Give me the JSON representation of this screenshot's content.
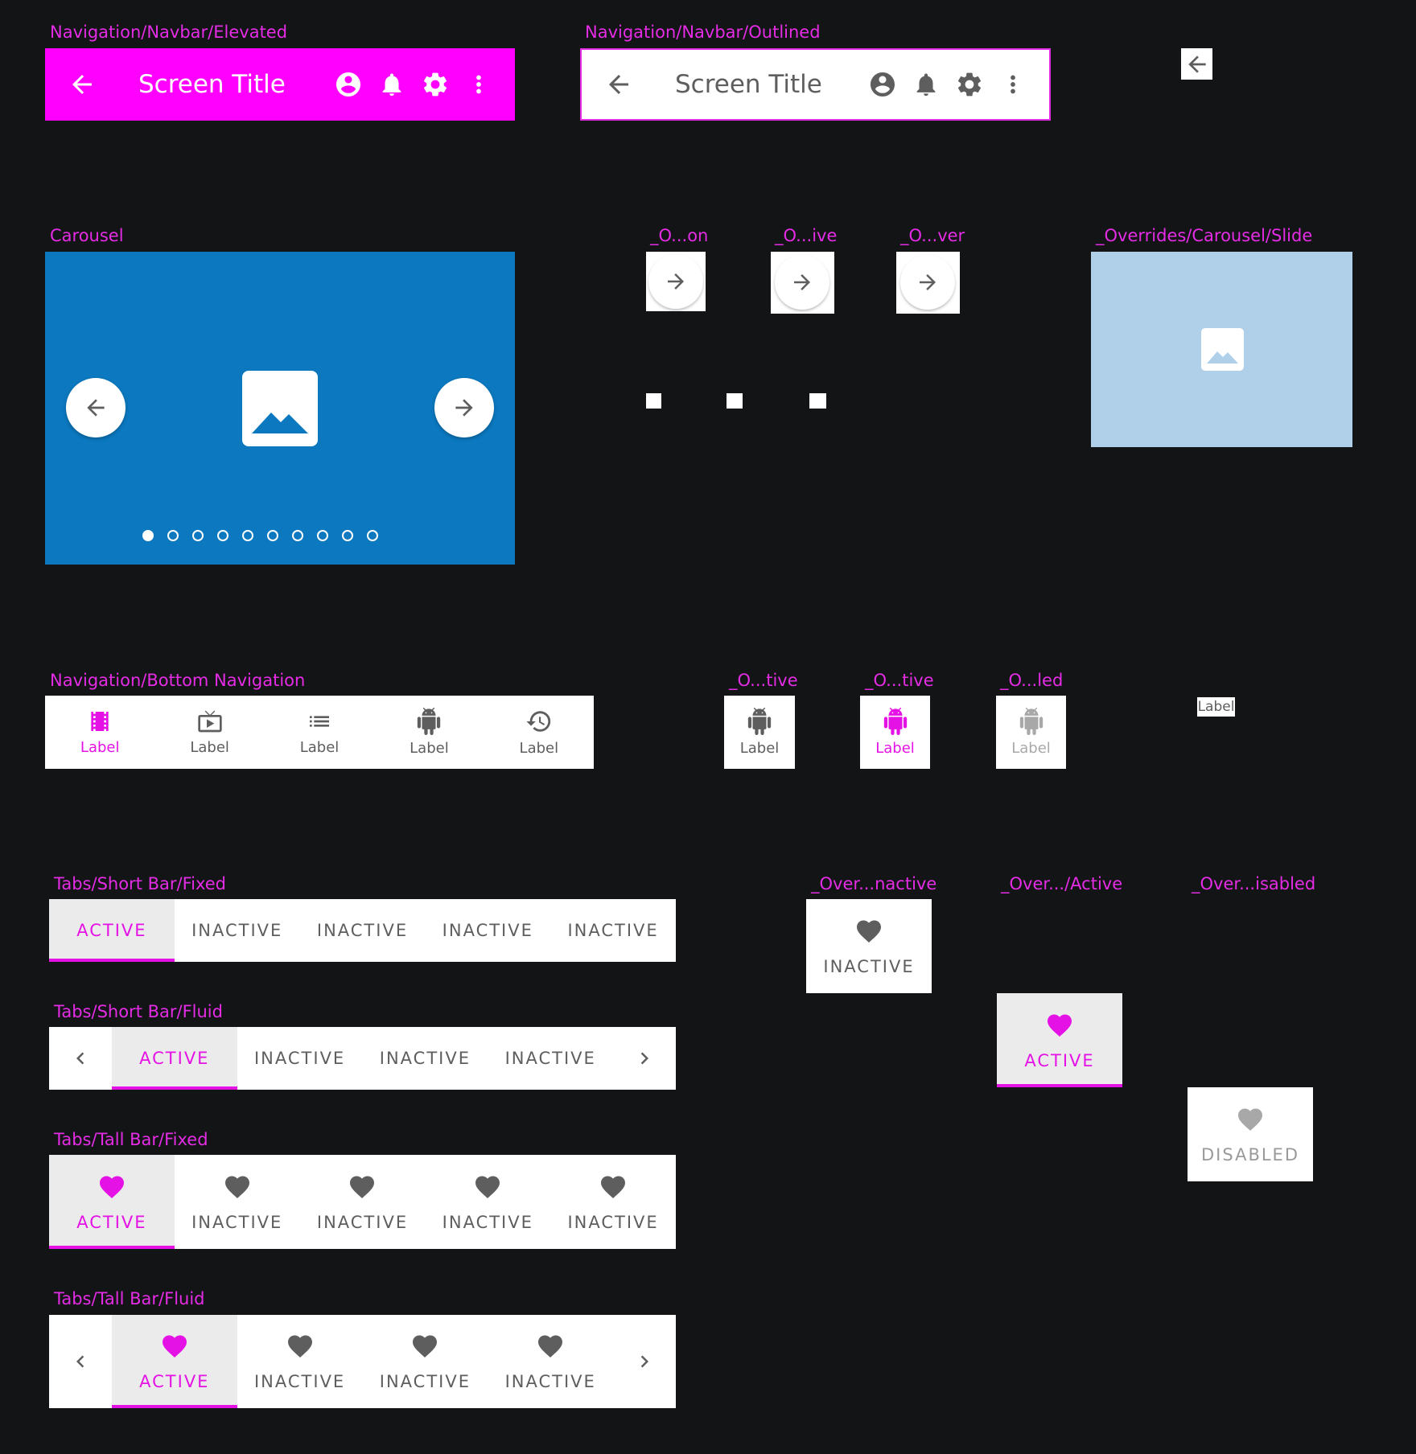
{
  "frames": {
    "navbar_elevated": "Navigation/Navbar/Elevated",
    "navbar_outlined": "Navigation/Navbar/Outlined",
    "carousel": "Carousel",
    "ov_button": "_O...on",
    "ov_active": "_O...ive",
    "ov_hover": "_O...ver",
    "ov_slide": "_Overrides/Carousel/Slide",
    "bottom_nav": "Navigation/Bottom Navigation",
    "bn_ov_inactive": "_O...tive",
    "bn_ov_active": "_O...tive",
    "bn_ov_disabled": "_O...led",
    "tabs_short_fixed": "Tabs/Short Bar/Fixed",
    "tabs_short_fluid": "Tabs/Short Bar/Fluid",
    "tabs_tall_fixed": "Tabs/Tall Bar/Fixed",
    "tabs_tall_fluid": "Tabs/Tall Bar/Fluid",
    "tab_ov_inactive": "_Over...nactive",
    "tab_ov_active": "_Over.../Active",
    "tab_ov_disabled": "_Over...isabled"
  },
  "navbar": {
    "title": "Screen Title",
    "icons": [
      "arrow-back-icon",
      "account-circle-icon",
      "bell-icon",
      "gear-icon",
      "more-vert-icon"
    ]
  },
  "carousel": {
    "slide_count": 10,
    "active_index": 0
  },
  "bottom_nav": {
    "items": [
      {
        "label": "Label",
        "icon": "film-icon",
        "state": "active"
      },
      {
        "label": "Label",
        "icon": "tv-icon",
        "state": "inactive"
      },
      {
        "label": "Label",
        "icon": "list-icon",
        "state": "inactive"
      },
      {
        "label": "Label",
        "icon": "android-icon",
        "state": "inactive"
      },
      {
        "label": "Label",
        "icon": "history-icon",
        "state": "inactive"
      }
    ],
    "overrides": {
      "inactive_label": "Label",
      "active_label": "Label",
      "disabled_label": "Label",
      "loose_label": "Label"
    }
  },
  "tabs": {
    "active": "ACTIVE",
    "inactive": "INACTIVE",
    "disabled": "DISABLED"
  },
  "colors": {
    "accent": "#e512e5",
    "label": "#e52ce5",
    "background": "#131416",
    "carousel_blue": "#0b78bf",
    "slide_blue": "#b0cfe8",
    "icon_gray": "#5e5e5e"
  }
}
